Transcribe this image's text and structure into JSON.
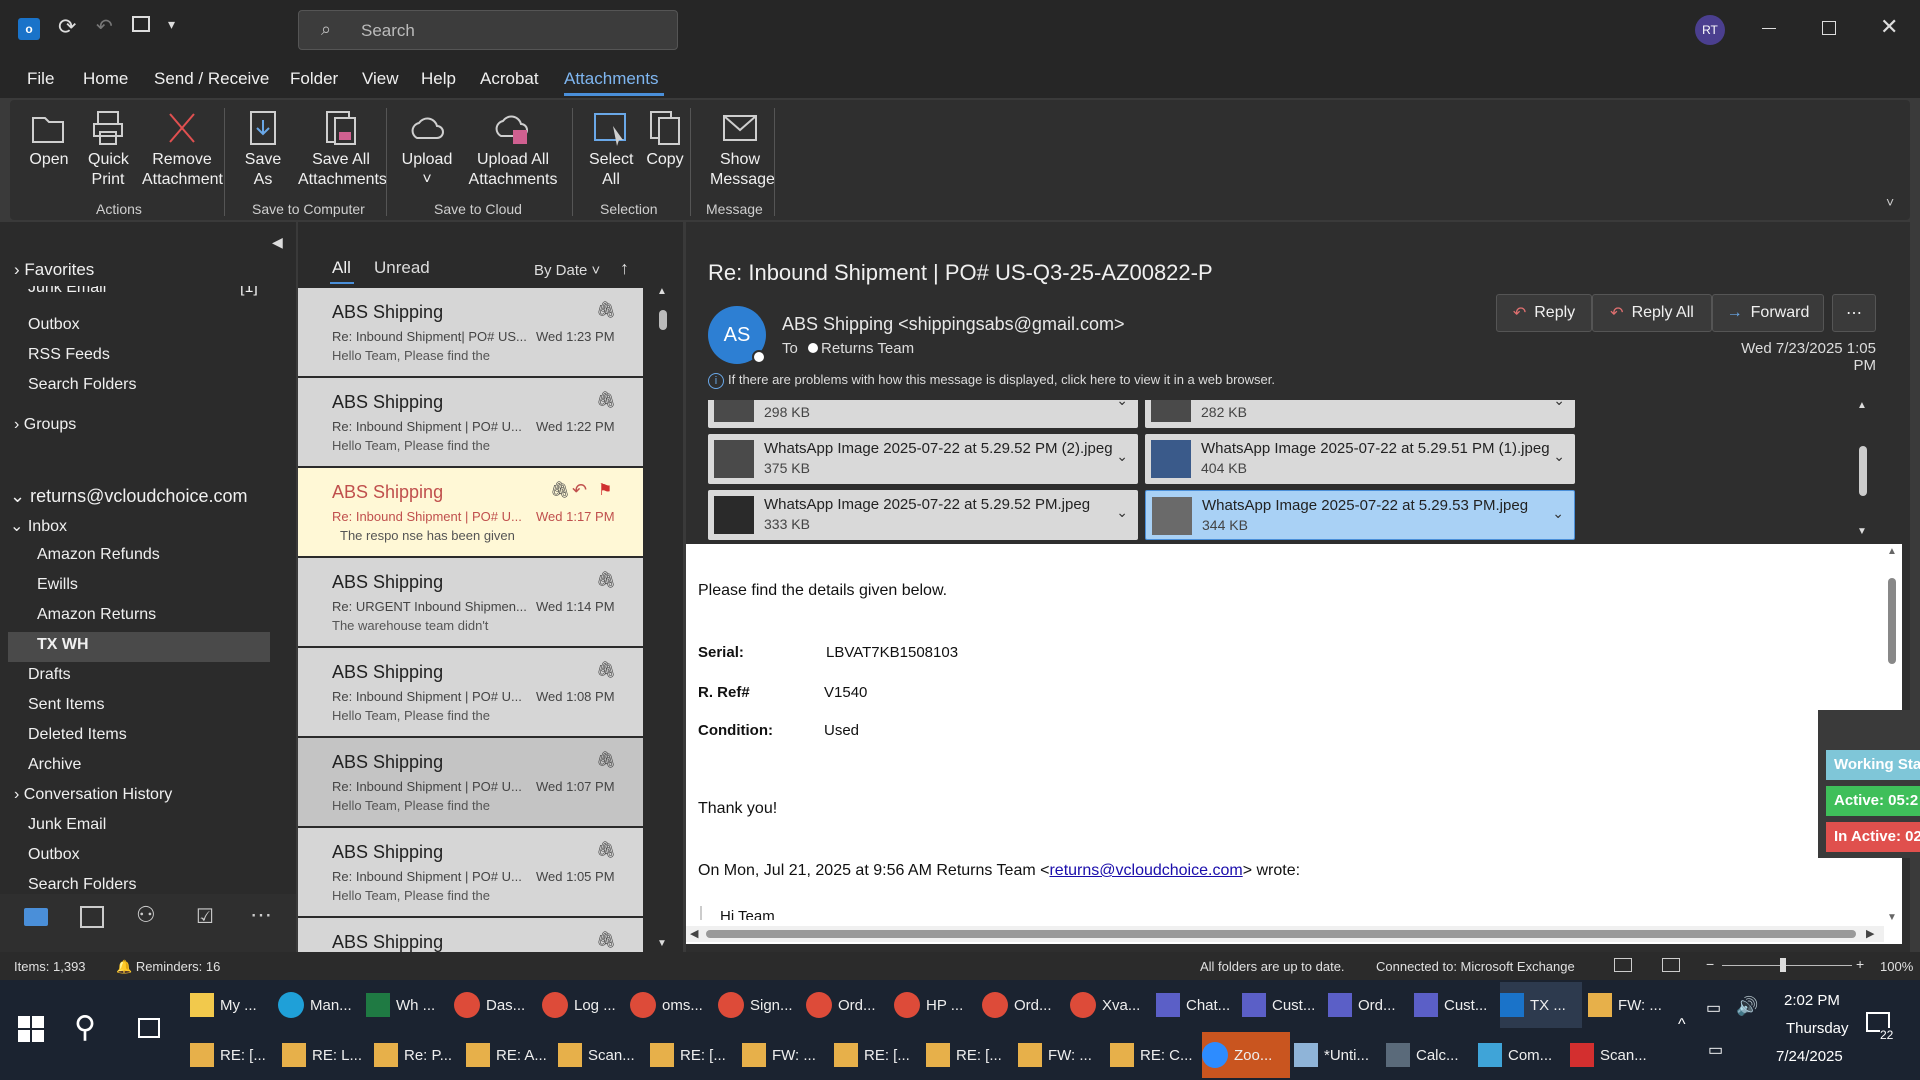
{
  "titlebar": {
    "search_placeholder": "Search",
    "avatar": "RT",
    "colors": {
      "accent": "#4a8fd9",
      "avatar_bg": "#4b3f8f"
    }
  },
  "menu": [
    "File",
    "Home",
    "Send / Receive",
    "Folder",
    "View",
    "Help",
    "Acrobat",
    "Attachments"
  ],
  "ribbon": {
    "buttons": [
      {
        "label": "Open",
        "icon": "folder-open-icon"
      },
      {
        "label": "Quick Print",
        "icon": "printer-icon"
      },
      {
        "label": "Remove Attachment",
        "icon": "remove-x-icon"
      },
      {
        "label": "Save As",
        "icon": "save-icon"
      },
      {
        "label": "Save All Attachments",
        "icon": "save-all-icon"
      },
      {
        "label": "Upload",
        "icon": "cloud-icon"
      },
      {
        "label": "Upload All Attachments",
        "icon": "cloud-upload-icon"
      },
      {
        "label": "Select All",
        "icon": "select-all-icon"
      },
      {
        "label": "Copy",
        "icon": "copy-icon"
      },
      {
        "label": "Show Message",
        "icon": "envelope-icon"
      }
    ],
    "groups": [
      "Actions",
      "Save to Computer",
      "Save to Cloud",
      "Selection",
      "Message"
    ]
  },
  "nav": {
    "favorites": "Favorites",
    "junk_top": "Junk Email",
    "junk_count": "[1]",
    "outbox1": "Outbox",
    "rss": "RSS Feeds",
    "search1": "Search Folders",
    "groups": "Groups",
    "account": "returns@vcloudchoice.com",
    "inbox": "Inbox",
    "subfolders": [
      "Amazon Refunds",
      "Ewills",
      "Amazon Returns",
      "TX WH"
    ],
    "folders": [
      "Drafts",
      "Sent Items",
      "Deleted Items",
      "Archive",
      "Conversation History",
      "Junk Email",
      "Outbox",
      "Search Folders"
    ]
  },
  "list": {
    "tabs": [
      "All",
      "Unread"
    ],
    "sort": "By Date",
    "items": [
      {
        "from": "ABS Shipping",
        "subject": "Re: Inbound Shipment| PO# US...",
        "time": "Wed 1:23 PM",
        "preview": "Hello Team,  Please find the"
      },
      {
        "from": "ABS Shipping",
        "subject": "Re: Inbound Shipment | PO# U...",
        "time": "Wed 1:22 PM",
        "preview": "Hello Team,  Please find the"
      },
      {
        "from": "ABS Shipping",
        "subject": "Re: Inbound Shipment | PO# U...",
        "time": "Wed 1:17 PM",
        "preview": "The respo  nse has been given"
      },
      {
        "from": "ABS Shipping",
        "subject": "Re: URGENT Inbound Shipmen...",
        "time": "Wed 1:14 PM",
        "preview": "The warehouse team didn't"
      },
      {
        "from": "ABS Shipping",
        "subject": "Re: Inbound Shipment | PO# U...",
        "time": "Wed 1:08 PM",
        "preview": "Hello Team,  Please find the"
      },
      {
        "from": "ABS Shipping",
        "subject": "Re: Inbound Shipment | PO# U...",
        "time": "Wed 1:07 PM",
        "preview": "Hello Team,  Please find the"
      },
      {
        "from": "ABS Shipping",
        "subject": "Re: Inbound Shipment | PO# U...",
        "time": "Wed 1:05 PM",
        "preview": "Hello Team,  Please find the"
      },
      {
        "from": "ABS Shipping",
        "subject": "",
        "time": "",
        "preview": ""
      }
    ]
  },
  "reading": {
    "subject": "Re: Inbound Shipment | PO# US-Q3-25-AZ00822-P",
    "initials": "AS",
    "sender": "ABS Shipping <shippingsabs@gmail.com>",
    "to_label": "To",
    "to": "Returns Team",
    "date": "Wed 7/23/2025 1:05 PM",
    "notice": "If there are problems with how this message is displayed, click here to view it in a web browser.",
    "reply": "Reply",
    "reply_all": "Reply All",
    "forward": "Forward",
    "attachments": [
      {
        "name": "",
        "size": "298 KB"
      },
      {
        "name": "",
        "size": "282 KB"
      },
      {
        "name": "WhatsApp Image 2025-07-22 at 5.29.52 PM (2).jpeg",
        "size": "375 KB"
      },
      {
        "name": "WhatsApp Image 2025-07-22 at 5.29.51 PM (1).jpeg",
        "size": "404 KB"
      },
      {
        "name": "WhatsApp Image 2025-07-22 at 5.29.52 PM.jpeg",
        "size": "333 KB"
      },
      {
        "name": "WhatsApp Image 2025-07-22 at 5.29.53 PM.jpeg",
        "size": "344 KB"
      }
    ],
    "body": {
      "line1": "Please find the details given below.",
      "serial_label": "Serial:",
      "serial": "LBVAT7KB1508103",
      "ref_label": "R. Ref#",
      "ref": "V1540",
      "cond_label": "Condition:",
      "cond": "Used",
      "thanks": "Thank you!",
      "quote_pre": "On Mon, Jul 21, 2025 at 9:56 AM Returns Team <",
      "quote_link": "returns@vcloudchoice.com",
      "quote_post": "> wrote:",
      "hi": "Hi Team"
    }
  },
  "widget": {
    "status": "Working Sta",
    "active": "Active: 05:2",
    "inactive": "In Active: 02"
  },
  "status": {
    "items": "Items: 1,393",
    "reminders": "Reminders: 16",
    "sync": "All folders are up to date.",
    "conn": "Connected to: Microsoft Exchange",
    "zoom": "100%"
  },
  "taskbar": {
    "row1": [
      "My ...",
      "Man...",
      "Wh ...",
      "Das...",
      "Log ...",
      "oms...",
      "Sign...",
      "Ord...",
      "HP ...",
      "Ord...",
      "Xva...",
      "Chat...",
      "Cust...",
      "Ord...",
      "Cust...",
      "TX ...",
      "FW: ..."
    ],
    "row2": [
      "RE: [...",
      "RE: L...",
      "Re: P...",
      "RE: A...",
      "Scan...",
      "RE: [...",
      "FW: ...",
      "RE: [...",
      "RE: [...",
      "FW: ...",
      "RE: C...",
      "Zoo...",
      "*Unti...",
      "Calc...",
      "Com...",
      "Scan..."
    ],
    "time": "2:02 PM",
    "day": "Thursday",
    "date": "7/24/2025",
    "notif": "22"
  }
}
